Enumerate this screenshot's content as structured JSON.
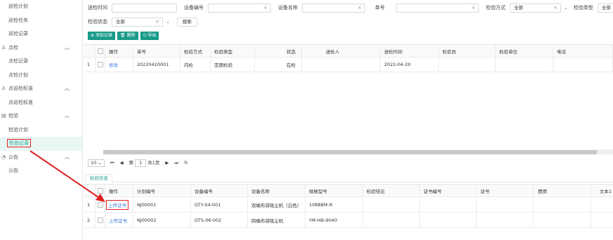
{
  "sidebar": {
    "items": [
      {
        "label": "巡检计划",
        "type": "item"
      },
      {
        "label": "巡检任务",
        "type": "item"
      },
      {
        "label": "巡检记录",
        "type": "item"
      },
      {
        "label": "点检",
        "type": "group",
        "icon": "person-icon"
      },
      {
        "label": "点检记录",
        "type": "item"
      },
      {
        "label": "点检计划",
        "type": "item"
      },
      {
        "label": "点巡检标准",
        "type": "group",
        "icon": "person-icon"
      },
      {
        "label": "点巡检标准",
        "type": "item"
      },
      {
        "label": "检验",
        "type": "group",
        "icon": "clipboard-icon"
      },
      {
        "label": "检验计划",
        "type": "item"
      },
      {
        "label": "检验记录",
        "type": "item",
        "active": true
      },
      {
        "label": "公告",
        "type": "group",
        "icon": "bell-icon"
      },
      {
        "label": "公告",
        "type": "item"
      }
    ],
    "chevron": "︽"
  },
  "filters": {
    "row1": [
      {
        "label": "送检时间",
        "value": ""
      },
      {
        "label": "设备编号",
        "value": ""
      },
      {
        "label": "设备名称",
        "value": ""
      },
      {
        "label": "单号",
        "value": ""
      },
      {
        "label": "检验方式",
        "value": "全部"
      },
      {
        "label": "检验类型",
        "value": "全部"
      }
    ],
    "status_label": "检验状态",
    "status_value": "全部",
    "search_button": "搜索"
  },
  "toolbar": {
    "add": "添加记录",
    "delete": "删除",
    "export": "导出"
  },
  "top_table": {
    "columns": [
      "操作",
      "单号",
      "检验方式",
      "检验类型",
      "状态",
      "送检人",
      "送检时间",
      "检验员",
      "检验单位",
      "电话"
    ],
    "rows": [
      {
        "index": "1",
        "action": "修改",
        "no": "20220420001",
        "method": "内检",
        "type": "定期检验",
        "status": "在检",
        "sender": "",
        "time": "2022-04-20",
        "inspector": "",
        "unit": "",
        "phone": ""
      }
    ]
  },
  "pager": {
    "page_size": "10",
    "page_prefix": "第",
    "page_value": "1",
    "page_total": "共1页"
  },
  "tab": "检验信息",
  "bottom_table": {
    "columns": [
      "操作",
      "计划编号",
      "设备编号",
      "设备名称",
      "规格型号",
      "检验结论",
      "证书编号",
      "证书",
      "费用",
      "文本1"
    ],
    "rows": [
      {
        "index": "1",
        "action": "上传证书",
        "plan": "NJ00001",
        "device_no": "GTY-04-001",
        "device_name": "双桶布袋吸尘机（白色）",
        "spec": "1088BM-R"
      },
      {
        "index": "2",
        "action": "上传证书",
        "plan": "NJ00002",
        "device_no": "GTS-06-002",
        "device_name": "四桶布袋吸尘机",
        "spec": "YM-HB-9040"
      }
    ]
  },
  "colors": {
    "accent": "#1a9b8a",
    "link": "#3a7bd5",
    "annotation": "#e02020"
  }
}
